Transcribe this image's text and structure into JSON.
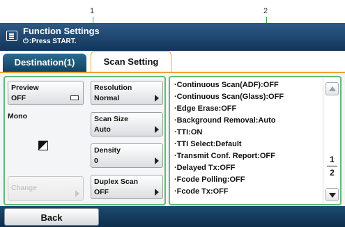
{
  "callouts": {
    "one": "1",
    "two": "2"
  },
  "header": {
    "title": "Function Settings",
    "subtitle": "Press START.",
    "start_glyph": "⏻"
  },
  "tabs": [
    {
      "label": "Destination(1)",
      "active": false
    },
    {
      "label": "Scan Setting",
      "active": true
    }
  ],
  "left_panel": {
    "preview": {
      "label": "Preview",
      "value": "OFF"
    },
    "mono_label": "Mono",
    "change_label": "Change",
    "resolution": {
      "label": "Resolution",
      "value": "Normal"
    },
    "scan_size": {
      "label": "Scan Size",
      "value": "Auto"
    },
    "density": {
      "label": "Density",
      "value": "0"
    },
    "duplex_scan": {
      "label": "Duplex Scan",
      "value": "OFF"
    }
  },
  "settings_list": [
    "·Continuous Scan(ADF):OFF",
    "·Continuous Scan(Glass):OFF",
    "·Edge Erase:OFF",
    "·Background Removal:Auto",
    "·TTI:ON",
    "·TTI Select:Default",
    "·Transmit Conf. Report:OFF",
    "·Delayed Tx:OFF",
    "·Fcode Polling:OFF",
    "·Fcode Tx:OFF"
  ],
  "pagination": {
    "current": "1",
    "total": "2"
  },
  "footer": {
    "back_label": "Back"
  },
  "colors": {
    "title_bar": "#12365c",
    "tab_accent": "#f0a030",
    "panel_border": "#62b873",
    "callout_line": "#2fa84f"
  }
}
